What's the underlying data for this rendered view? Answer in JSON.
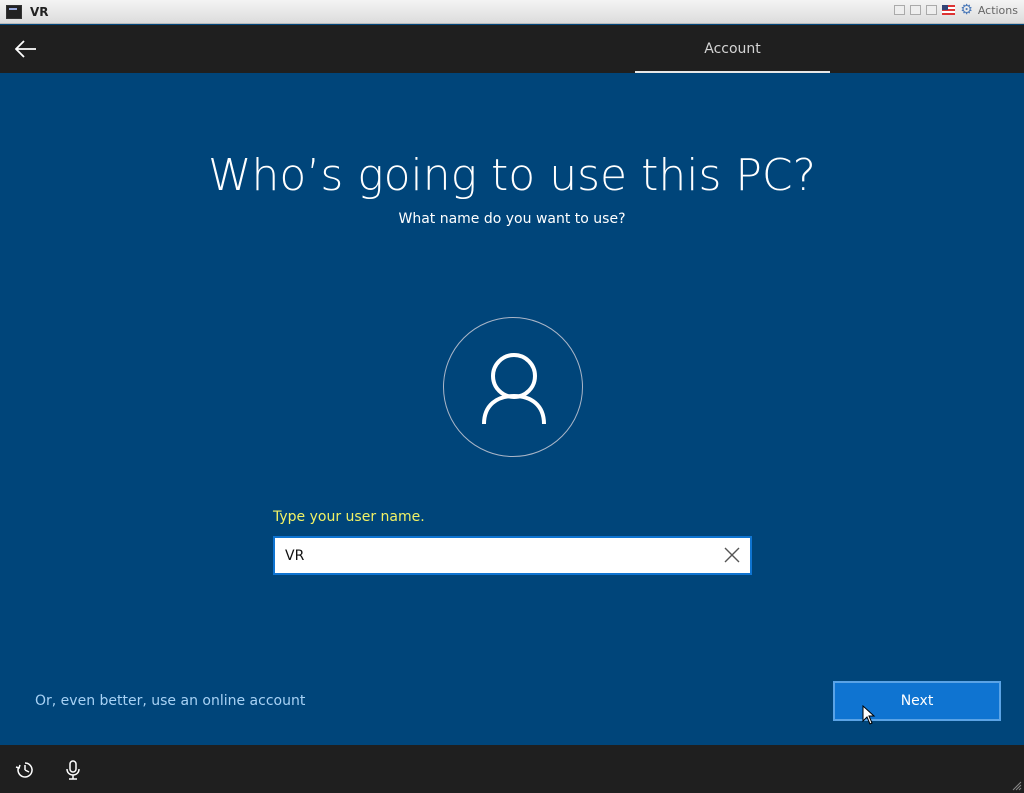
{
  "window": {
    "title": "VR",
    "actions_label": "Actions"
  },
  "header": {
    "tab_label": "Account"
  },
  "main": {
    "title": "Who’s going to use this PC?",
    "subtitle": "What name do you want to use?",
    "field_label": "Type your user name.",
    "username_value": "VR"
  },
  "footer": {
    "online_link": "Or, even better, use an online account",
    "next_label": "Next"
  },
  "icons": {
    "back": "back-arrow-icon",
    "avatar": "user-icon",
    "clear": "close-icon",
    "ease": "ease-of-access-icon",
    "mic": "microphone-icon"
  },
  "colors": {
    "background": "#00457a",
    "bar": "#1f1f1f",
    "accent": "#0f74d1",
    "label": "#f1f165",
    "link": "#a8d2f5"
  }
}
